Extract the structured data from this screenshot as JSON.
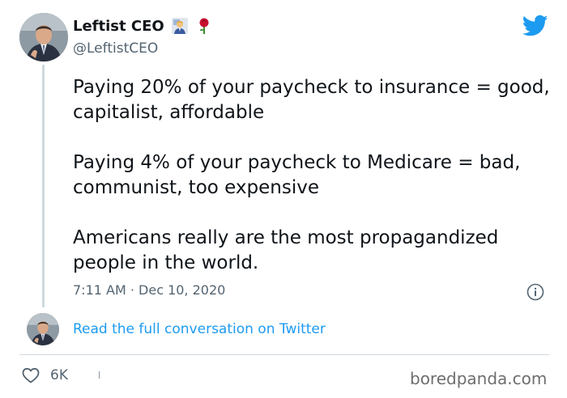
{
  "author": {
    "display_name": "Leftist CEO",
    "handle": "@LeftistCEO",
    "badges": [
      "man-office-worker-emoji",
      "red-rose-emoji"
    ]
  },
  "tweet": {
    "paragraphs": [
      "Paying 20% of your paycheck to insurance = good, capitalist, affordable",
      "Paying 4% of your paycheck to Medicare = bad, communist, too expensive",
      "Americans really are the most propagandized people in the world."
    ],
    "timestamp": "7:11 AM · Dec 10, 2020"
  },
  "actions": {
    "read_conversation_label": "Read the full conversation on Twitter",
    "like_count": "6K"
  },
  "brand": {
    "twitter_blue": "#1d9bf0",
    "watermark": "boredpanda.com"
  },
  "icons": {
    "logo": "twitter-bird-icon",
    "info": "info-icon",
    "like": "heart-icon"
  }
}
